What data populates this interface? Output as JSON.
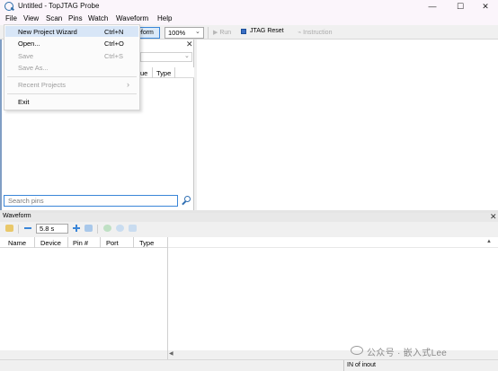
{
  "window": {
    "title": "Untitled - TopJTAG Probe",
    "min_glyph": "—",
    "max_glyph": "☐",
    "close_glyph": "✕"
  },
  "menubar": [
    "File",
    "View",
    "Scan",
    "Pins",
    "Watch",
    "Waveform",
    "Help"
  ],
  "file_menu": {
    "items": [
      {
        "label": "New Project Wizard",
        "shortcut": "Ctrl+N",
        "enabled": true,
        "highlighted": true
      },
      {
        "label": "Open...",
        "shortcut": "Ctrl+O",
        "enabled": true
      },
      {
        "label": "Save",
        "shortcut": "Ctrl+S",
        "enabled": false
      },
      {
        "label": "Save As...",
        "shortcut": "",
        "enabled": false
      },
      {
        "label": "Recent Projects",
        "shortcut": "",
        "enabled": false,
        "submenu_glyph": "›"
      },
      {
        "label": "Exit",
        "shortcut": "",
        "enabled": true
      }
    ]
  },
  "toolbar": {
    "waveform_partial": "eform",
    "zoom": "100%",
    "zoom_arrow": "⌄",
    "run": "Run",
    "jtag_reset": "JTAG Reset",
    "instruction": "Instruction"
  },
  "pins_panel": {
    "close_glyph": "✕",
    "combo_arrow": "⌄",
    "columns_partial": [
      "ue",
      "Type"
    ],
    "search_placeholder": "Search pins"
  },
  "waveform_panel": {
    "title": "Waveform",
    "close_glyph": "✕",
    "time": "5.8 s",
    "columns": [
      "Name",
      "Device",
      "Pin #",
      "Port",
      "Type"
    ],
    "ruler_arrow": "▲",
    "scroll_left": "◀"
  },
  "statusbar": {
    "direction": "IN of inout"
  },
  "watermark": "公众号 · 嵌入式Lee",
  "colors": {
    "accent": "#3b86d8",
    "menu_highlight": "#d8e6f7",
    "disabled_text": "#9c9c9c"
  }
}
